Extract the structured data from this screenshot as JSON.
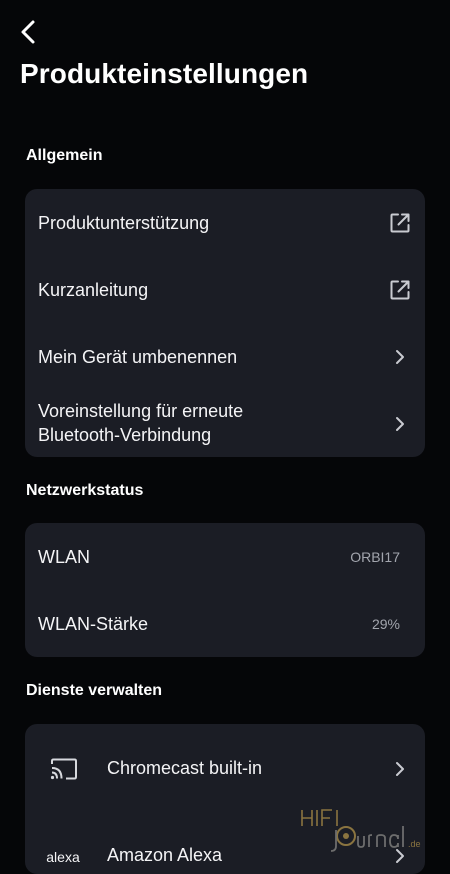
{
  "header": {
    "back_icon": "chevron-left-icon",
    "title": "Produkteinstellungen"
  },
  "sections": {
    "general": {
      "title": "Allgemein",
      "items": [
        {
          "label": "Produktunterstützung",
          "icon": "external-link-icon"
        },
        {
          "label": "Kurzanleitung",
          "icon": "external-link-icon"
        },
        {
          "label": "Mein Gerät umbenennen",
          "icon": "chevron-right-icon"
        },
        {
          "label_line1": "Voreinstellung für erneute",
          "label_line2": "Bluetooth-Verbindung",
          "icon": "chevron-right-icon"
        }
      ]
    },
    "network": {
      "title": "Netzwerkstatus",
      "items": [
        {
          "label": "WLAN",
          "value": "ORBI17"
        },
        {
          "label": "WLAN-Stärke",
          "value": "29%"
        }
      ]
    },
    "services": {
      "title": "Dienste verwalten",
      "items": [
        {
          "label": "Chromecast built-in",
          "icon": "cast-icon"
        },
        {
          "label": "Amazon Alexa",
          "icon": "alexa-logo",
          "logo_text": "alexa"
        }
      ]
    }
  },
  "watermark": {
    "text": "HIFI Journal.de",
    "colors": {
      "gold": "#8a7440",
      "grey": "#6d6d6d"
    }
  },
  "colors": {
    "background": "#050608",
    "card": "#1b1d25",
    "text": "#f4f4f6",
    "muted": "#a2a5ad"
  }
}
